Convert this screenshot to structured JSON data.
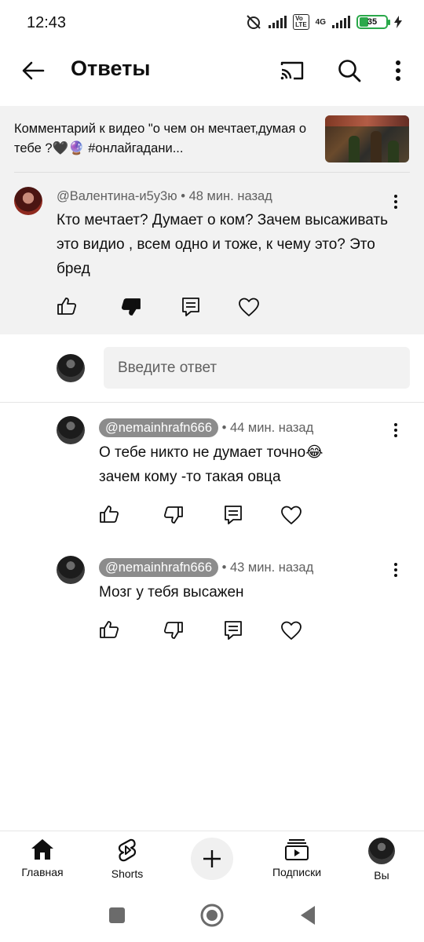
{
  "status_bar": {
    "time": "12:43",
    "network": "4G",
    "battery": "35",
    "battery_level": 0.35
  },
  "header": {
    "title": "Ответы"
  },
  "parent": {
    "video_context": "Комментарий к видео \"о чем он мечтает,думая о тебе ?🖤🔮 #онлайгадани...",
    "author": "@Валентина-и5у3ю",
    "time": "• 48 мин. назад",
    "text": "Кто мечтает? Думает о ком? Зачем высаживать это видио , всем одно и тоже, к чему это? Это бред"
  },
  "reply_box": {
    "placeholder": "Введите ответ"
  },
  "replies": [
    {
      "author": "@nemainhrafn666",
      "time": "• 44 мин. назад",
      "text": "О тебе никто не думает точно😂 зачем кому -то такая овца"
    },
    {
      "author": "@nemainhrafn666",
      "time": "• 43 мин. назад",
      "text": "Мозг у тебя высажен"
    }
  ],
  "bottom_nav": {
    "home": "Главная",
    "shorts": "Shorts",
    "subscriptions": "Подписки",
    "you": "Вы"
  },
  "colors": {
    "panel_bg": "#f2f2f2",
    "chip_bg": "#8c8c8c",
    "battery": "#2aa84a"
  },
  "icons": [
    "back-arrow-icon",
    "cast-icon",
    "search-icon",
    "more-vert-icon",
    "like-icon",
    "dislike-icon",
    "reply-icon",
    "heart-icon",
    "home-icon",
    "shorts-icon",
    "plus-icon",
    "subscriptions-icon"
  ]
}
